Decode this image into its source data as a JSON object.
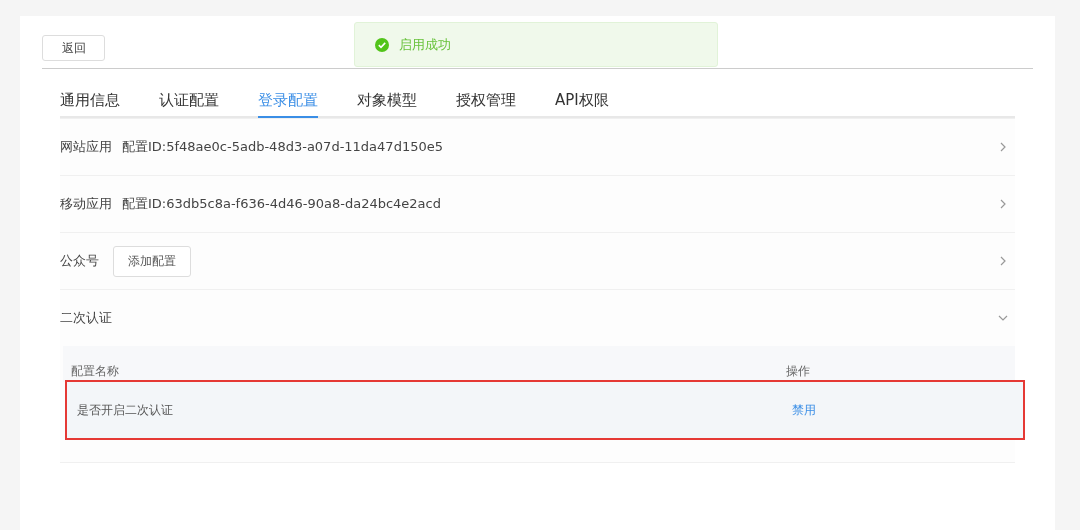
{
  "back_button": "返回",
  "toast": {
    "kind": "success",
    "text": "启用成功"
  },
  "tabs": [
    {
      "label": "通用信息",
      "selected": false
    },
    {
      "label": "认证配置",
      "selected": false
    },
    {
      "label": "登录配置",
      "selected": true
    },
    {
      "label": "对象模型",
      "selected": false
    },
    {
      "label": "授权管理",
      "selected": false
    },
    {
      "label": "API权限",
      "selected": false
    }
  ],
  "sections": [
    {
      "label": "网站应用",
      "kind": "text",
      "value": "配置ID:5f48ae0c-5adb-48d3-a07d-11da47d150e5",
      "expanded": false
    },
    {
      "label": "移动应用",
      "kind": "text",
      "value": "配置ID:63db5c8a-f636-4d46-90a8-da24bc4e2acd",
      "expanded": false
    },
    {
      "label": "公众号",
      "kind": "button",
      "value": "添加配置",
      "expanded": false
    },
    {
      "label": "二次认证",
      "kind": "plain",
      "expanded": true,
      "table": {
        "columns": [
          "配置名称",
          "操作"
        ],
        "rows": [
          {
            "name": "是否开启二次认证",
            "action": "禁用",
            "highlighted": true
          }
        ]
      }
    }
  ]
}
